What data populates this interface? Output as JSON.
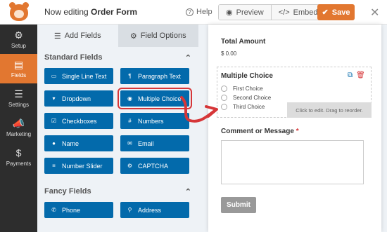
{
  "header": {
    "editing_prefix": "Now editing",
    "form_name": "Order Form",
    "help": "Help",
    "preview": "Preview",
    "embed": "Embed",
    "save": "Save"
  },
  "sidebar": {
    "items": [
      {
        "label": "Setup",
        "icon": "gear-icon"
      },
      {
        "label": "Fields",
        "icon": "fields-icon"
      },
      {
        "label": "Settings",
        "icon": "sliders-icon"
      },
      {
        "label": "Marketing",
        "icon": "megaphone-icon"
      },
      {
        "label": "Payments",
        "icon": "dollar-icon"
      }
    ]
  },
  "panel": {
    "tabs": [
      "Add Fields",
      "Field Options"
    ],
    "standard_title": "Standard Fields",
    "standard_fields": [
      {
        "label": "Single Line Text",
        "icon": "▭"
      },
      {
        "label": "Paragraph Text",
        "icon": "¶"
      },
      {
        "label": "Dropdown",
        "icon": "▾"
      },
      {
        "label": "Multiple Choice",
        "icon": "◉"
      },
      {
        "label": "Checkboxes",
        "icon": "☑"
      },
      {
        "label": "Numbers",
        "icon": "#"
      },
      {
        "label": "Name",
        "icon": "●"
      },
      {
        "label": "Email",
        "icon": "✉"
      },
      {
        "label": "Number Slider",
        "icon": "≡"
      },
      {
        "label": "CAPTCHA",
        "icon": "⚙"
      }
    ],
    "fancy_title": "Fancy Fields",
    "fancy_fields": [
      {
        "label": "Phone",
        "icon": "✆"
      },
      {
        "label": "Address",
        "icon": "⚲"
      }
    ]
  },
  "form": {
    "total_label": "Total Amount",
    "total_value": "$ 0.00",
    "mc_label": "Multiple Choice",
    "choices": [
      "First Choice",
      "Second Choice",
      "Third Choice"
    ],
    "tip": "Click to edit. Drag to reorder.",
    "comment_label": "Comment or Message",
    "required_mark": "*",
    "submit": "Submit"
  },
  "colors": {
    "accent": "#e27730",
    "field_button": "#036aab",
    "highlight": "#d63638"
  }
}
